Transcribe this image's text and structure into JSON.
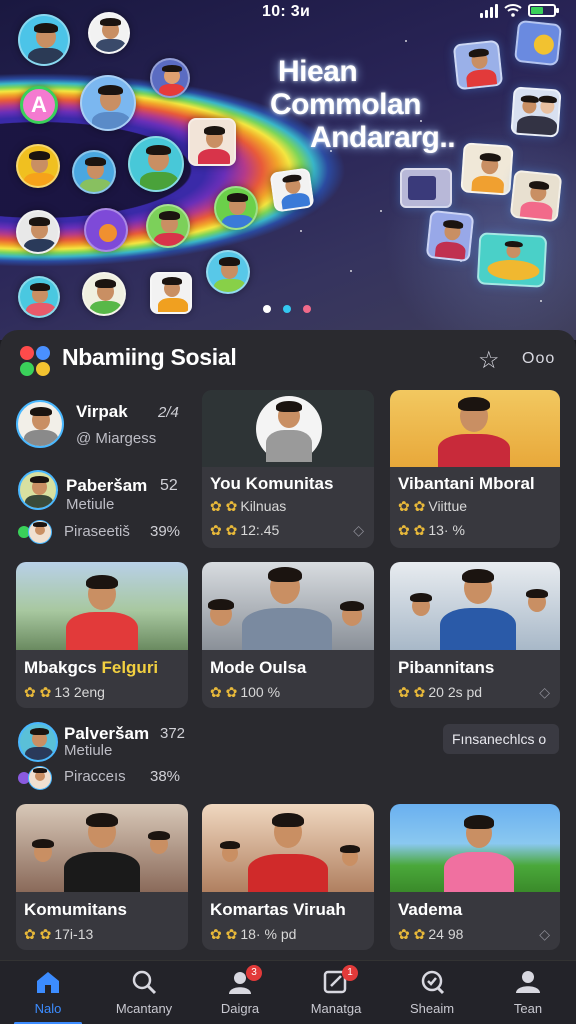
{
  "status": {
    "time": "10: 3и"
  },
  "hero": {
    "title_lines": [
      "Hiean",
      "Commolan",
      "Andararɡ.."
    ],
    "pager_colors": [
      "#ffffff",
      "#34c8f0",
      "#f06a8a"
    ]
  },
  "header": {
    "app_title": "Nbamiing Sosial",
    "logo_colors": [
      "#ff4b4b",
      "#4a90ff",
      "#3ad15a",
      "#f2c230"
    ],
    "more_label": "Ooo"
  },
  "list_items": [
    {
      "name": "Virpak",
      "sub": "@ Miargess",
      "num": "2/4"
    },
    {
      "name": "Paberšam",
      "sub": "Metiule",
      "num": "52",
      "sub2": "Piraseetiš",
      "pct": "39%"
    },
    {
      "name": "Palveršam",
      "sub": "Metiule",
      "num": "372",
      "sub2": "Piracceıs",
      "pct": "38%"
    }
  ],
  "cards": [
    {
      "title": "You Komunitas",
      "meta": "Kilnuas",
      "meta2": "12:.45"
    },
    {
      "title": "Vibantani Mboral",
      "meta": "Viittue",
      "meta2": "13· %"
    },
    {
      "title": "Mbakgcs",
      "title_accent": "Felguri",
      "meta2": "13 2eng"
    },
    {
      "title": "Mode Oulsa",
      "meta2": "100 %"
    },
    {
      "title": "Pibannitans",
      "meta2": "20 2s pd"
    },
    {
      "title": "Komumitans",
      "meta2": "17i-13"
    },
    {
      "title": "Komartas Viruah",
      "meta2": "18· % pd"
    },
    {
      "title": "Vadema",
      "meta2": "24 98"
    }
  ],
  "chip": {
    "label": "Fınsanechlcs o"
  },
  "nav": [
    {
      "label": "Nalo",
      "icon": "home-icon",
      "active": true
    },
    {
      "label": "Mcantany",
      "icon": "search-icon"
    },
    {
      "label": "Daigra",
      "icon": "person-icon",
      "badge": "3"
    },
    {
      "label": "Manatga",
      "icon": "edit-icon",
      "badge": "1"
    },
    {
      "label": "Sheaim",
      "icon": "search-check-icon"
    },
    {
      "label": "Tean",
      "icon": "profile-icon"
    }
  ],
  "colors": {
    "accent": "#3c8cff",
    "badge": "#e23a3a",
    "coin": "#e8b93a",
    "panel": "#2a2a2f",
    "card": "#38383e"
  }
}
